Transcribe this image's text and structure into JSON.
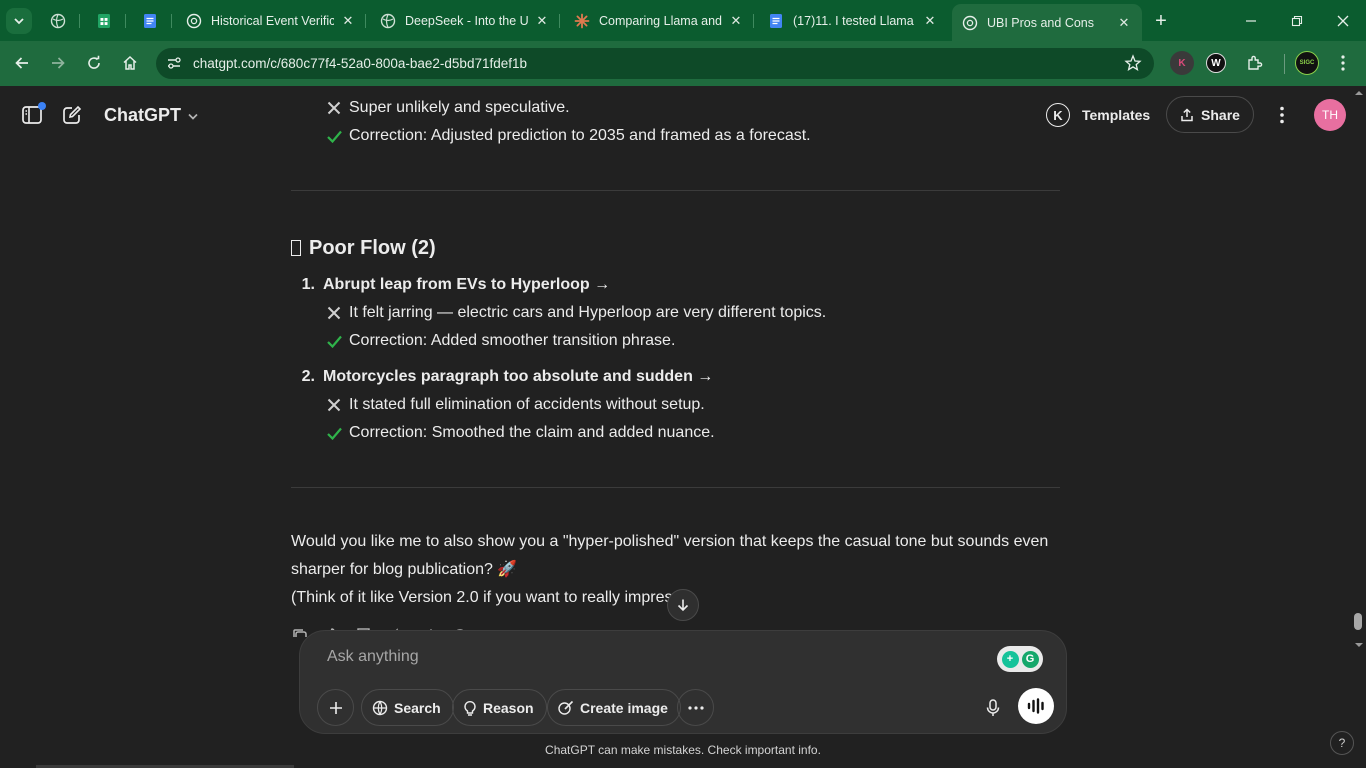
{
  "browser": {
    "tabs": [
      {
        "title": "",
        "icon": "globe-icon"
      },
      {
        "title": "",
        "icon": "sheets-icon"
      },
      {
        "title": "",
        "icon": "docs-icon"
      },
      {
        "title": "Historical Event Verifica",
        "icon": "openai-icon"
      },
      {
        "title": "DeepSeek - Into the Un",
        "icon": "globe-icon"
      },
      {
        "title": "Comparing Llama and (",
        "icon": "claude-icon"
      },
      {
        "title": "(17)11. I tested Llama a",
        "icon": "docs-icon"
      },
      {
        "title": "UBI Pros and Cons",
        "icon": "openai-icon"
      }
    ],
    "url": "chatgpt.com/c/680c77f4-52a0-800a-bae2-d5bd71fdef1b",
    "extensions": [
      "K",
      "W"
    ],
    "profile_label": "SIGC"
  },
  "header": {
    "model": "ChatGPT",
    "templates_label": "Templates",
    "templates_badge": "K",
    "share_label": "Share",
    "avatar_initials": "TH"
  },
  "conversation": {
    "top_items": [
      {
        "mark": "cross",
        "text": "Super unlikely and speculative."
      },
      {
        "mark": "check",
        "text": "Correction: Adjusted prediction to 2035 and framed as a forecast."
      }
    ],
    "section_title": "Poor Flow (2)",
    "numbered": [
      {
        "num": "1.",
        "title": "Abrupt leap from EVs to Hyperloop →",
        "items": [
          {
            "mark": "cross",
            "text": "It felt jarring — electric cars and Hyperloop are very different topics."
          },
          {
            "mark": "check",
            "text": "Correction: Added smoother transition phrase."
          }
        ]
      },
      {
        "num": "2.",
        "title": "Motorcycles paragraph too absolute and sudden →",
        "items": [
          {
            "mark": "cross",
            "text": "It stated full elimination of accidents without setup."
          },
          {
            "mark": "check",
            "text": "Correction: Smoothed the claim and added nuance."
          }
        ]
      }
    ],
    "closing_line1": "Would you like me to also show you a \"hyper-polished\" version that keeps the casual tone but sounds even",
    "closing_line2": "sharper for blog publication? 🚀",
    "closing_line3": "(Think of it like Version 2.0 if you want to really impres"
  },
  "composer": {
    "placeholder": "Ask anything",
    "search_label": "Search",
    "reason_label": "Reason",
    "create_image_label": "Create image"
  },
  "footer": {
    "disclaimer": "ChatGPT can make mistakes. Check important info.",
    "help": "?"
  },
  "colors": {
    "browser_frame": "#0b5c2f",
    "browser_toolbar": "#1f6b3e",
    "page_bg": "#212121",
    "check": "#2fb34a",
    "avatar": "#e86fa0"
  }
}
